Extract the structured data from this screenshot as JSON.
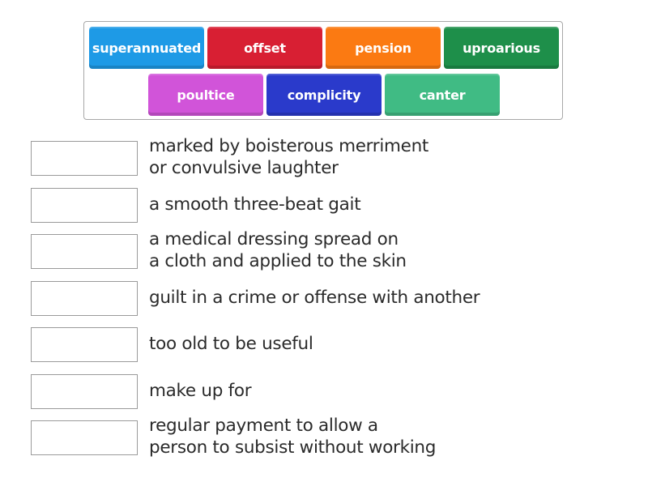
{
  "word_bank": {
    "tiles": [
      {
        "label": "superannuated",
        "color": "#1e9ae6"
      },
      {
        "label": "offset",
        "color": "#d81f33"
      },
      {
        "label": "pension",
        "color": "#fb7a12"
      },
      {
        "label": "uproarious",
        "color": "#1e8f4a"
      },
      {
        "label": "poultice",
        "color": "#d154d9"
      },
      {
        "label": "complicity",
        "color": "#2a3acb"
      },
      {
        "label": "canter",
        "color": "#40bb84"
      }
    ]
  },
  "matches": [
    {
      "definition_lines": [
        "marked by boisterous merriment",
        "or convulsive laughter"
      ],
      "answer": ""
    },
    {
      "definition_lines": [
        "a smooth three-beat gait"
      ],
      "answer": ""
    },
    {
      "definition_lines": [
        "a medical dressing spread on",
        "a cloth and applied to the skin"
      ],
      "answer": ""
    },
    {
      "definition_lines": [
        "guilt in a crime or offense with another"
      ],
      "answer": ""
    },
    {
      "definition_lines": [
        "too old to be useful"
      ],
      "answer": ""
    },
    {
      "definition_lines": [
        "make up for"
      ],
      "answer": ""
    },
    {
      "definition_lines": [
        "regular payment to allow a",
        "person to subsist without working"
      ],
      "answer": ""
    }
  ]
}
